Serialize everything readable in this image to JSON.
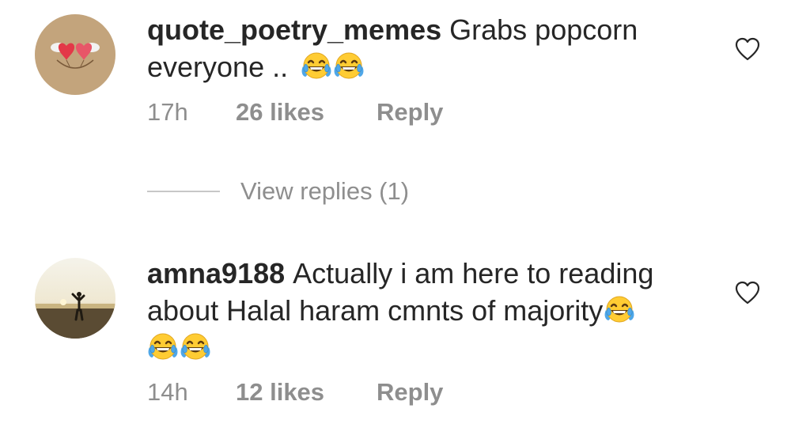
{
  "comments": [
    {
      "username": "quote_poetry_memes",
      "text": "Grabs popcorn everyone ..",
      "time": "17h",
      "likes": "26 likes",
      "reply_label": "Reply",
      "emojis": [
        "joy-emoji",
        "joy-emoji"
      ]
    },
    {
      "username": "amna9188",
      "text": "Actually i am here to reading about Halal haram cmnts of majority",
      "time": "14h",
      "likes": "12 likes",
      "reply_label": "Reply",
      "emojis": [
        "joy-emoji",
        "joy-emoji",
        "joy-emoji"
      ]
    }
  ],
  "view_replies": {
    "label": "View replies (1)"
  },
  "icons": {
    "like": "heart-outline-icon",
    "emoji": "face-with-tears-of-joy"
  },
  "colors": {
    "text": "#262626",
    "secondary": "#8e8e8e",
    "divider": "#c7c7c7",
    "emoji_face": "#ffcc33",
    "emoji_tears": "#4fa7e8"
  }
}
